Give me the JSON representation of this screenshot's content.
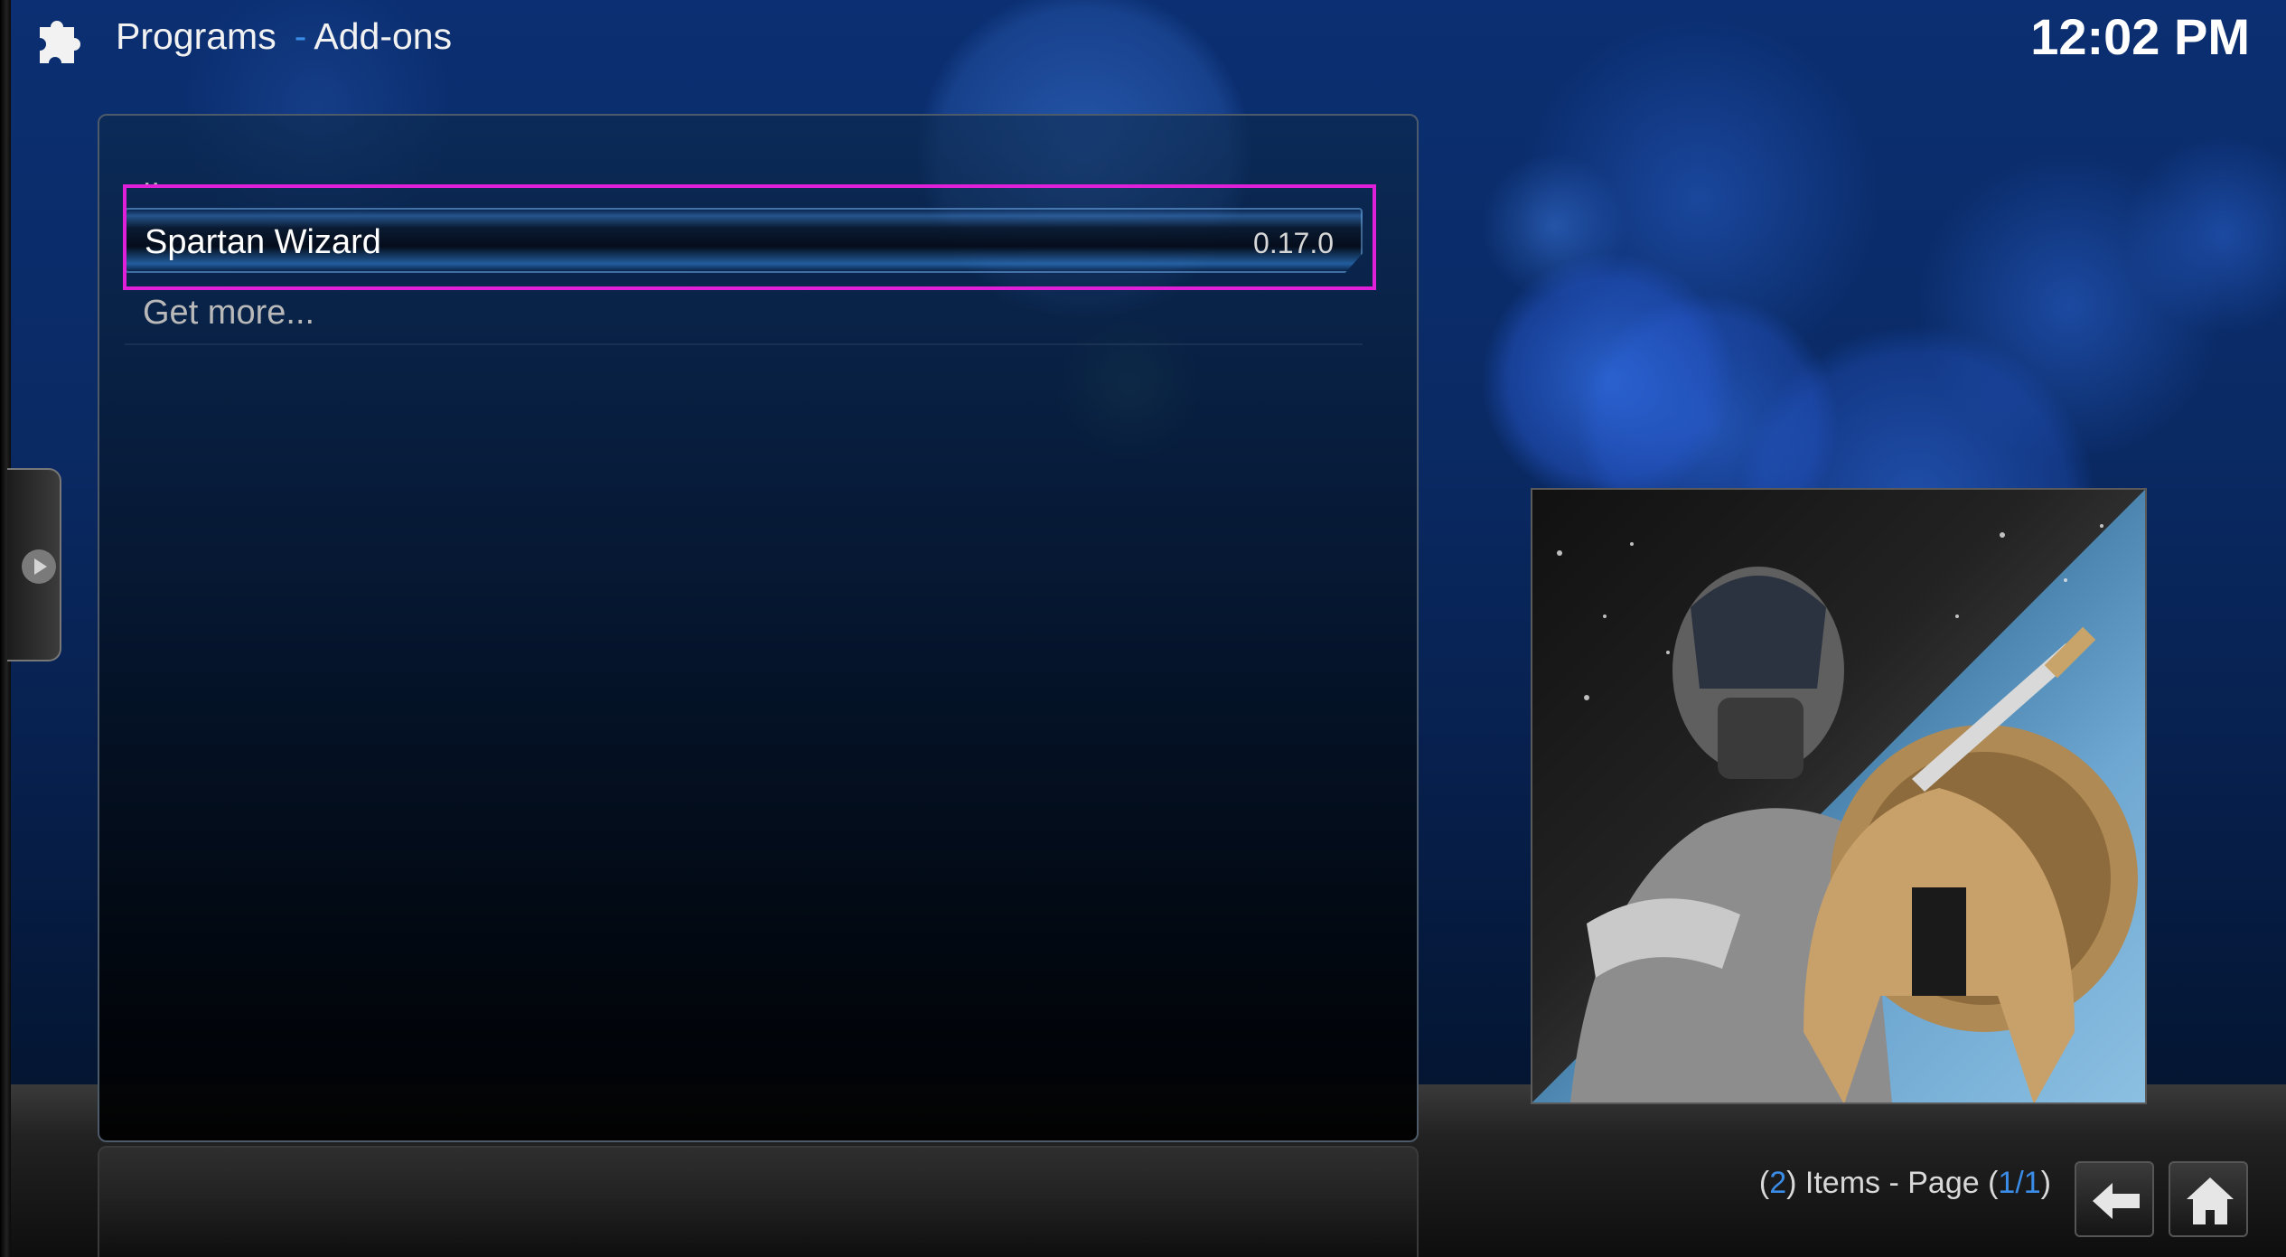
{
  "header": {
    "section": "Programs",
    "separator": "-",
    "subsection": "Add-ons",
    "clock": "12:02 PM",
    "icon": "puzzle-icon"
  },
  "list": {
    "parent_item": "..",
    "items": [
      {
        "label": "Spartan Wizard",
        "version": "0.17.0",
        "selected": true
      },
      {
        "label": "Get more..."
      }
    ]
  },
  "thumbnail": {
    "icon": "addon-fanart-image"
  },
  "status": {
    "open1": "(",
    "count": "2",
    "mid": ") Items - Page (",
    "page": "1/1",
    "close": ")"
  },
  "nav": {
    "back_icon": "back-arrow-icon",
    "home_icon": "home-icon"
  },
  "colors": {
    "accent": "#3a8ce6",
    "highlight": "#e020d8"
  }
}
